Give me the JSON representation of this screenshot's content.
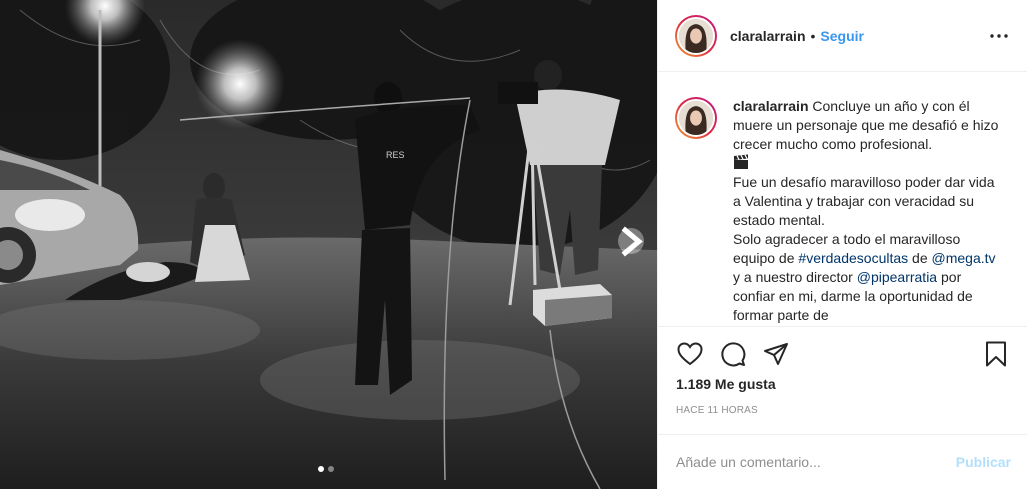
{
  "post": {
    "username": "claralarrain",
    "separator": "•",
    "follow_label": "Seguir",
    "more_icon": "more-horizontal-icon"
  },
  "caption": {
    "username": "claralarrain",
    "line1": "Concluye un año y con él muere un personaje que me desafió e hizo crecer mucho como profesional.",
    "emoji": "clapper-board-icon",
    "line2": "Fue un desafío maravilloso poder dar vida a Valentina y trabajar con veracidad su estado mental.",
    "line3_pre": "Solo agradecer a todo el maravilloso equipo de ",
    "hashtag": "#verdadesocultas",
    "line3_mid": " de ",
    "mention1": "@mega.tv",
    "line3_mid2": " y a nuestro director ",
    "mention2": "@pipearratia",
    "line3_post": " por confiar en mi, darme la oportunidad de formar parte de"
  },
  "actions": {
    "like_icon": "heart-icon",
    "comment_icon": "comment-icon",
    "share_icon": "share-icon",
    "save_icon": "bookmark-icon"
  },
  "likes_text": "1.189 Me gusta",
  "timestamp": "HACE 11 HORAS",
  "comment": {
    "placeholder": "Añade un comentario...",
    "value": "",
    "post_label": "Publicar"
  },
  "carousel": {
    "total": 2,
    "active": 1
  },
  "colors": {
    "link": "#3897f0",
    "tag": "#003569",
    "muted": "#8e8e8e",
    "post_disabled": "#b2dffc",
    "border": "#efefef"
  }
}
